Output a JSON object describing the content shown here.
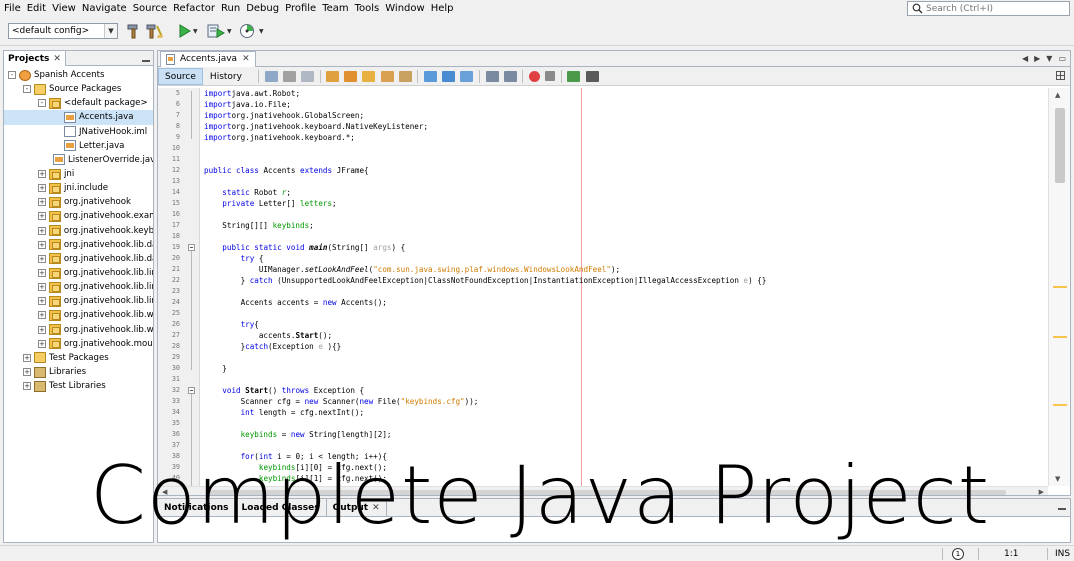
{
  "menu": [
    "File",
    "Edit",
    "View",
    "Navigate",
    "Source",
    "Refactor",
    "Run",
    "Debug",
    "Profile",
    "Team",
    "Tools",
    "Window",
    "Help"
  ],
  "search": {
    "placeholder": "Search (Ctrl+I)",
    "icon": "search-icon"
  },
  "toolbar": {
    "config_value": "<default config>",
    "icons": [
      "hammer-icon",
      "clean-build-icon",
      "run-icon",
      "debug-icon",
      "profile-icon"
    ]
  },
  "projects": {
    "tab_label": "Projects",
    "tree": [
      {
        "label": "Spanish Accents",
        "level": 0,
        "toggle": "-",
        "icon": "project"
      },
      {
        "label": "Source Packages",
        "level": 1,
        "toggle": "-",
        "icon": "folder"
      },
      {
        "label": "<default package>",
        "level": 2,
        "toggle": "-",
        "icon": "pkg"
      },
      {
        "label": "Accents.java",
        "level": 3,
        "toggle": "",
        "icon": "java",
        "selected": true
      },
      {
        "label": "JNativeHook.iml",
        "level": 3,
        "toggle": "",
        "icon": "file"
      },
      {
        "label": "Letter.java",
        "level": 3,
        "toggle": "",
        "icon": "java"
      },
      {
        "label": "ListenerOverride.java",
        "level": 3,
        "toggle": "",
        "icon": "java"
      },
      {
        "label": "jni",
        "level": 2,
        "toggle": "+",
        "icon": "pkg"
      },
      {
        "label": "jni.include",
        "level": 2,
        "toggle": "+",
        "icon": "pkg"
      },
      {
        "label": "org.jnativehook",
        "level": 2,
        "toggle": "+",
        "icon": "pkg"
      },
      {
        "label": "org.jnativehook.example",
        "level": 2,
        "toggle": "+",
        "icon": "pkg"
      },
      {
        "label": "org.jnativehook.keyboard",
        "level": 2,
        "toggle": "+",
        "icon": "pkg"
      },
      {
        "label": "org.jnativehook.lib.darwin",
        "level": 2,
        "toggle": "+",
        "icon": "pkg"
      },
      {
        "label": "org.jnativehook.lib.darwin",
        "level": 2,
        "toggle": "+",
        "icon": "pkg"
      },
      {
        "label": "org.jnativehook.lib.linux",
        "level": 2,
        "toggle": "+",
        "icon": "pkg"
      },
      {
        "label": "org.jnativehook.lib.linux",
        "level": 2,
        "toggle": "+",
        "icon": "pkg"
      },
      {
        "label": "org.jnativehook.lib.linux",
        "level": 2,
        "toggle": "+",
        "icon": "pkg"
      },
      {
        "label": "org.jnativehook.lib.windows",
        "level": 2,
        "toggle": "+",
        "icon": "pkg"
      },
      {
        "label": "org.jnativehook.lib.windows",
        "level": 2,
        "toggle": "+",
        "icon": "pkg"
      },
      {
        "label": "org.jnativehook.mouse",
        "level": 2,
        "toggle": "+",
        "icon": "pkg"
      },
      {
        "label": "Test Packages",
        "level": 1,
        "toggle": "+",
        "icon": "folder"
      },
      {
        "label": "Libraries",
        "level": 1,
        "toggle": "+",
        "icon": "lib"
      },
      {
        "label": "Test Libraries",
        "level": 1,
        "toggle": "+",
        "icon": "lib"
      }
    ]
  },
  "editor": {
    "tab_label": "Accents.java",
    "view_source": "Source",
    "view_history": "History",
    "lines": [
      {
        "n": "5",
        "tokens": [
          [
            "kw",
            "import"
          ],
          [
            "",
            "java.awt.Robot;"
          ]
        ]
      },
      {
        "n": "6",
        "tokens": [
          [
            "kw",
            "import"
          ],
          [
            "",
            "java.io.File;"
          ]
        ]
      },
      {
        "n": "7",
        "tokens": [
          [
            "kw",
            "import"
          ],
          [
            "",
            "org.jnativehook.GlobalScreen;"
          ]
        ]
      },
      {
        "n": "8",
        "tokens": [
          [
            "kw",
            "import"
          ],
          [
            "",
            "org.jnativehook.keyboard.NativeKeyListener;"
          ]
        ]
      },
      {
        "n": "9",
        "tokens": [
          [
            "kw",
            "import"
          ],
          [
            "",
            "org.jnativehook.keyboard.*;"
          ]
        ]
      },
      {
        "n": "10",
        "tokens": []
      },
      {
        "n": "11",
        "tokens": []
      },
      {
        "n": "12",
        "tokens": [
          [
            "kw",
            "public class"
          ],
          [
            "",
            " Accents "
          ],
          [
            "kw",
            "extends"
          ],
          [
            "",
            " JFrame{"
          ]
        ]
      },
      {
        "n": "13",
        "tokens": []
      },
      {
        "n": "14",
        "tokens": [
          [
            "",
            "    "
          ],
          [
            "kw",
            "static"
          ],
          [
            "",
            " Robot "
          ],
          [
            "fld it",
            "r"
          ],
          [
            "",
            ";"
          ]
        ]
      },
      {
        "n": "15",
        "tokens": [
          [
            "",
            "    "
          ],
          [
            "kw",
            "private"
          ],
          [
            "",
            " Letter[] "
          ],
          [
            "fld",
            "letters"
          ],
          [
            "",
            ";"
          ]
        ]
      },
      {
        "n": "16",
        "tokens": []
      },
      {
        "n": "17",
        "tokens": [
          [
            "",
            "    String[][] "
          ],
          [
            "fld",
            "keybinds"
          ],
          [
            "",
            ";"
          ]
        ]
      },
      {
        "n": "18",
        "tokens": []
      },
      {
        "n": "19",
        "tokens": [
          [
            "",
            "    "
          ],
          [
            "kw",
            "public static void"
          ],
          [
            "",
            " "
          ],
          [
            "fn it",
            "main"
          ],
          [
            "",
            "(String[] "
          ],
          [
            "param",
            "args"
          ],
          [
            "",
            ") {"
          ]
        ]
      },
      {
        "n": "20",
        "tokens": [
          [
            "",
            "        "
          ],
          [
            "kw",
            "try"
          ],
          [
            "",
            " {"
          ]
        ]
      },
      {
        "n": "21",
        "tokens": [
          [
            "",
            "            UIManager."
          ],
          [
            "it",
            "setLookAndFeel"
          ],
          [
            "",
            "("
          ],
          [
            "str",
            "\"com.sun.java.swing.plaf.windows.WindowsLookAndFeel\""
          ],
          [
            "",
            ");"
          ]
        ]
      },
      {
        "n": "22",
        "tokens": [
          [
            "",
            "        } "
          ],
          [
            "kw",
            "catch"
          ],
          [
            "",
            " (UnsupportedLookAndFeelException|ClassNotFoundException|InstantiationException|IllegalAccessException "
          ],
          [
            "param",
            "e"
          ],
          [
            "",
            ") {}"
          ]
        ]
      },
      {
        "n": "23",
        "tokens": []
      },
      {
        "n": "24",
        "tokens": [
          [
            "",
            "        Accents accents = "
          ],
          [
            "kw",
            "new"
          ],
          [
            "",
            " Accents();"
          ]
        ]
      },
      {
        "n": "25",
        "tokens": []
      },
      {
        "n": "26",
        "tokens": [
          [
            "",
            "        "
          ],
          [
            "kw",
            "try"
          ],
          [
            "",
            "{"
          ]
        ]
      },
      {
        "n": "27",
        "tokens": [
          [
            "",
            "            accents."
          ],
          [
            "fn",
            "Start"
          ],
          [
            "",
            "();"
          ]
        ]
      },
      {
        "n": "28",
        "tokens": [
          [
            "",
            "        }"
          ],
          [
            "kw",
            "catch"
          ],
          [
            "",
            "(Exception "
          ],
          [
            "param",
            "e"
          ],
          [
            "",
            " ){}"
          ]
        ]
      },
      {
        "n": "29",
        "tokens": []
      },
      {
        "n": "30",
        "tokens": [
          [
            "",
            "    }"
          ]
        ]
      },
      {
        "n": "31",
        "tokens": []
      },
      {
        "n": "32",
        "tokens": [
          [
            "",
            "    "
          ],
          [
            "kw",
            "void"
          ],
          [
            "",
            " "
          ],
          [
            "fn",
            "Start"
          ],
          [
            "",
            "() "
          ],
          [
            "kw",
            "throws"
          ],
          [
            "",
            " Exception {"
          ]
        ]
      },
      {
        "n": "33",
        "tokens": [
          [
            "",
            "        Scanner cfg = "
          ],
          [
            "kw",
            "new"
          ],
          [
            "",
            " Scanner("
          ],
          [
            "kw",
            "new"
          ],
          [
            "",
            " File("
          ],
          [
            "str",
            "\"keybinds.cfg\""
          ],
          [
            "",
            "));"
          ]
        ]
      },
      {
        "n": "34",
        "tokens": [
          [
            "",
            "        "
          ],
          [
            "kw",
            "int"
          ],
          [
            "",
            " length = cfg.nextInt();"
          ]
        ]
      },
      {
        "n": "35",
        "tokens": []
      },
      {
        "n": "36",
        "tokens": [
          [
            "",
            "        "
          ],
          [
            "fld",
            "keybinds"
          ],
          [
            "",
            " = "
          ],
          [
            "kw",
            "new"
          ],
          [
            "",
            " String[length][2];"
          ]
        ]
      },
      {
        "n": "37",
        "tokens": []
      },
      {
        "n": "38",
        "tokens": [
          [
            "",
            "        "
          ],
          [
            "kw",
            "for"
          ],
          [
            "",
            "("
          ],
          [
            "kw",
            "int"
          ],
          [
            "",
            " i = 0; i < length; i++){"
          ]
        ]
      },
      {
        "n": "39",
        "tokens": [
          [
            "",
            "            "
          ],
          [
            "fld",
            "keybinds"
          ],
          [
            "",
            "[i][0] = cfg.next();"
          ]
        ]
      },
      {
        "n": "40",
        "tokens": [
          [
            "",
            "            "
          ],
          [
            "fld",
            "keybinds"
          ],
          [
            "",
            "[i][1] = cfg.next();"
          ]
        ]
      }
    ]
  },
  "bottom_tabs": [
    {
      "label": "Notifications",
      "closable": false
    },
    {
      "label": "Loaded Classes",
      "closable": false
    },
    {
      "label": "Output",
      "closable": true
    }
  ],
  "status": {
    "position": "1:1",
    "mode": "INS"
  },
  "overlay": {
    "caption": "Complete Java Project"
  },
  "colors": {
    "keyword": "#0000e6",
    "string": "#ce7b00",
    "field": "#009900",
    "selection": "#cde3f7"
  }
}
